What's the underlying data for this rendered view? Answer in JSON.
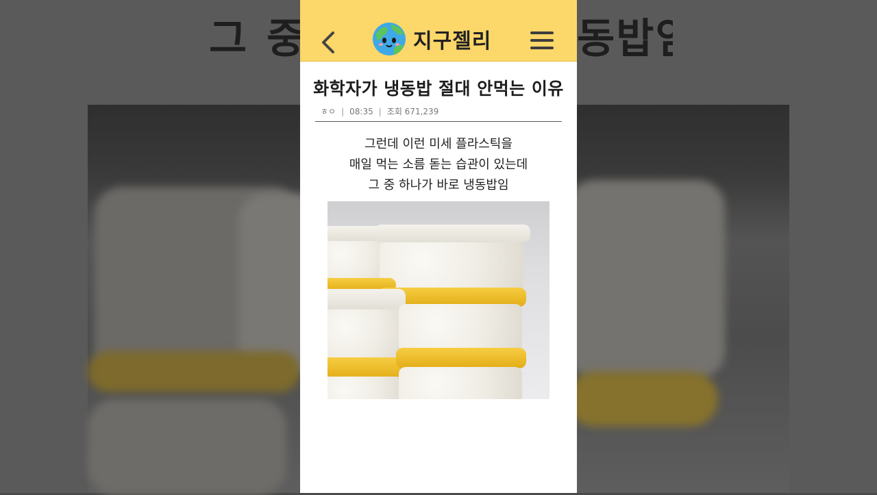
{
  "background": {
    "caption_left": "그 중",
    "caption_right": "동밥임"
  },
  "header": {
    "logo_text": "지구젤리",
    "bg_color": "#fcd769"
  },
  "article": {
    "title": "화학자가 냉동밥 절대 안먹는 이유",
    "author": "ㅎㅇ",
    "time": "08:35",
    "views": "조회 671,239",
    "lines": [
      "그런데 이런 미세 플라스틱을",
      "매일 먹는 소름 돋는 습관이 있는데",
      "그 중 하나가 바로 냉동밥임"
    ]
  },
  "icons": {
    "back": "chevron-left-icon",
    "menu": "hamburger-menu-icon",
    "logo": "earth-mascot-icon"
  }
}
